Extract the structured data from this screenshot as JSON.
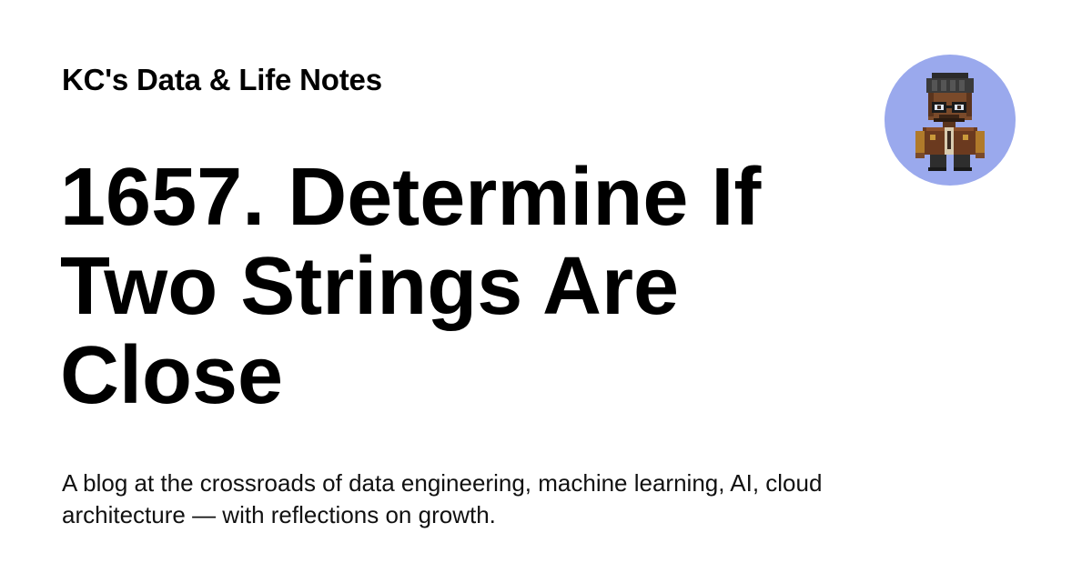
{
  "site": {
    "title": "KC's Data & Life Notes"
  },
  "post": {
    "title": "1657. Determine If Two Strings Are Close"
  },
  "tagline": "A blog at the crossroads of data engineering, machine learning, AI, cloud architecture — with reflections on growth.",
  "avatar": {
    "icon": "pixel-art-person-with-glasses-icon",
    "background_color": "#9aa9ed"
  }
}
